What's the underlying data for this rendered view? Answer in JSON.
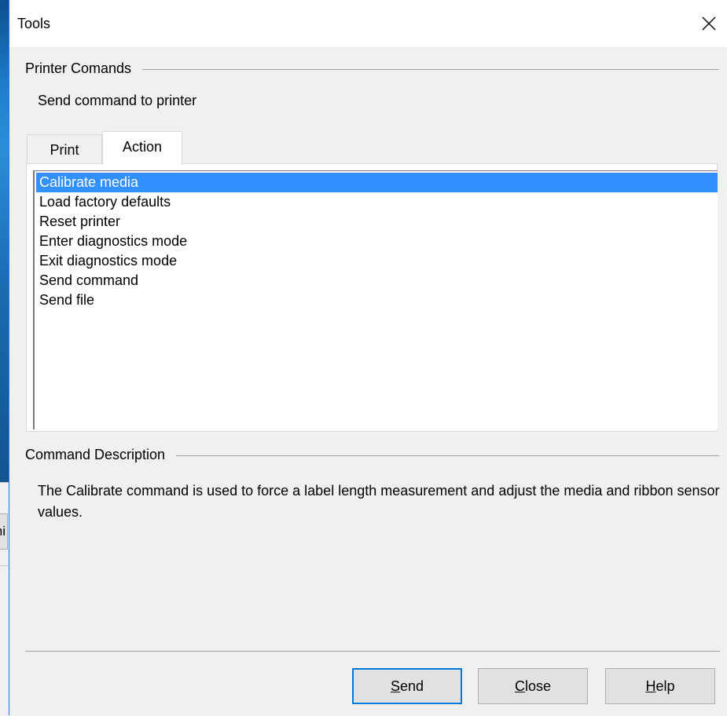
{
  "background_app": {
    "button_fragment": "hi"
  },
  "dialog": {
    "title": "Tools",
    "close_icon": "close-icon"
  },
  "printer_commands": {
    "group_label": "Printer Comands",
    "subtitle": "Send command to printer",
    "tabs": [
      {
        "label": "Print",
        "active": false
      },
      {
        "label": "Action",
        "active": true
      }
    ],
    "actions": [
      {
        "label": "Calibrate media",
        "selected": true
      },
      {
        "label": "Load factory defaults",
        "selected": false
      },
      {
        "label": "Reset printer",
        "selected": false
      },
      {
        "label": "Enter diagnostics mode",
        "selected": false
      },
      {
        "label": "Exit diagnostics mode",
        "selected": false
      },
      {
        "label": "Send command",
        "selected": false
      },
      {
        "label": "Send file",
        "selected": false
      }
    ]
  },
  "command_description": {
    "group_label": "Command Description",
    "text": "The Calibrate command is used to force a label length measurement and adjust the media and ribbon sensor values."
  },
  "buttons": {
    "send": {
      "first": "S",
      "rest": "end"
    },
    "close": {
      "first": "C",
      "rest": "lose"
    },
    "help": {
      "first": "H",
      "rest": "elp"
    }
  },
  "colors": {
    "selection": "#3390ff",
    "window_border": "#2b79d8",
    "default_button_border": "#0078d7"
  }
}
